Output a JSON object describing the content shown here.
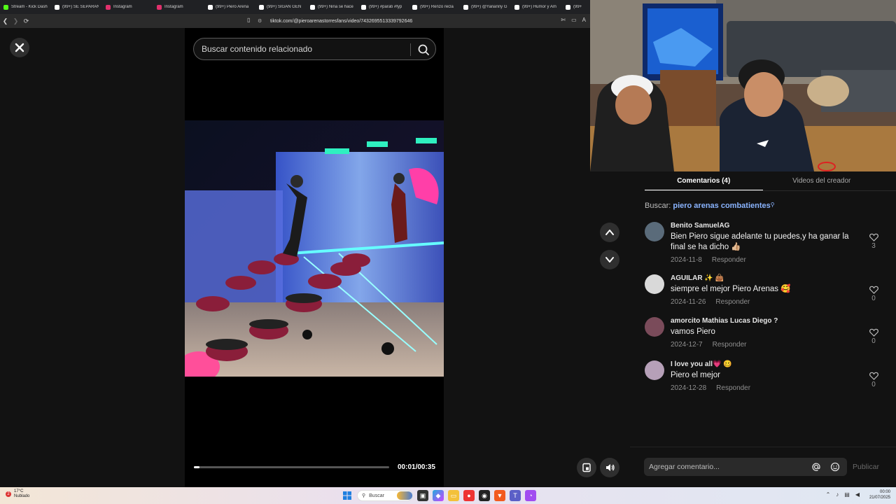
{
  "browser": {
    "tabs": [
      {
        "label": "Stream - Kick Dash",
        "icon": "kick-icon",
        "color": "#53fc18"
      },
      {
        "label": "(99+) SE SEPARAN",
        "icon": "tiktok-icon",
        "color": "#ffffff"
      },
      {
        "label": "Instagram",
        "icon": "instagram-icon",
        "color": "#e1306c"
      },
      {
        "label": "Instagram",
        "icon": "instagram-icon",
        "color": "#e1306c"
      },
      {
        "label": "(99+) Piero Arena",
        "icon": "tiktok-icon",
        "color": "#ffffff"
      },
      {
        "label": "(99+) SIGAN GEN",
        "icon": "tiktok-icon",
        "color": "#ffffff"
      },
      {
        "label": "(99+) Niña se hace",
        "icon": "tiktok-icon",
        "color": "#ffffff"
      },
      {
        "label": "(99+) #parati #fyp",
        "icon": "tiktok-icon",
        "color": "#ffffff"
      },
      {
        "label": "(99+) Renzo recla",
        "icon": "tiktok-icon",
        "color": "#ffffff"
      },
      {
        "label": "(99+) @Yarianny G",
        "icon": "tiktok-icon",
        "color": "#ffffff"
      },
      {
        "label": "(99+) Humor y Am",
        "icon": "tiktok-icon",
        "color": "#ffffff"
      },
      {
        "label": "(99+",
        "icon": "tiktok-icon",
        "color": "#ffffff"
      }
    ],
    "url": "tiktok.com/@pieroarenastorresfans/video/7432695513339792646"
  },
  "search": {
    "placeholder": "Buscar contenido relacionado"
  },
  "player": {
    "current_time": "00:01",
    "duration": "00:35",
    "time_display": "00:01/00:35",
    "progress_fraction": 0.03
  },
  "panel": {
    "tabs": [
      {
        "label": "Comentarios (4)",
        "active": true
      },
      {
        "label": "Videos del creador",
        "active": false
      }
    ],
    "search_prefix": "Buscar:",
    "search_query": "piero arenas combatientes",
    "comments": [
      {
        "user": "Benito SamuelAG",
        "text": "Bien Piero sigue adelante tu puedes,y ha ganar la final se ha dicho 👍🏼",
        "date": "2024-11-8",
        "reply": "Responder",
        "likes": "3",
        "avatar_color": "#5a6b7a"
      },
      {
        "user": "AGUILAR ✨ 👜",
        "text": "siempre el mejor Piero Arenas 🥰",
        "date": "2024-11-26",
        "reply": "Responder",
        "likes": "0",
        "avatar_color": "#d9d9d9"
      },
      {
        "user": "amorcito Mathias Lucas Diego ?",
        "text": "vamos Piero",
        "date": "2024-12-7",
        "reply": "Responder",
        "likes": "0",
        "avatar_color": "#7a4b5a"
      },
      {
        "user": "I love you all💗 🥴",
        "text": "Piero el mejor",
        "date": "2024-12-28",
        "reply": "Responder",
        "likes": "0",
        "avatar_color": "#b6a0b8"
      }
    ],
    "comment_placeholder": "Agregar comentario...",
    "publish_label": "Publicar"
  },
  "taskbar": {
    "weather_temp": "17°C",
    "weather_desc": "Nublado",
    "search_label": "Buscar",
    "time": "00:00",
    "date": "21/07/2025",
    "notification_count": "2"
  }
}
